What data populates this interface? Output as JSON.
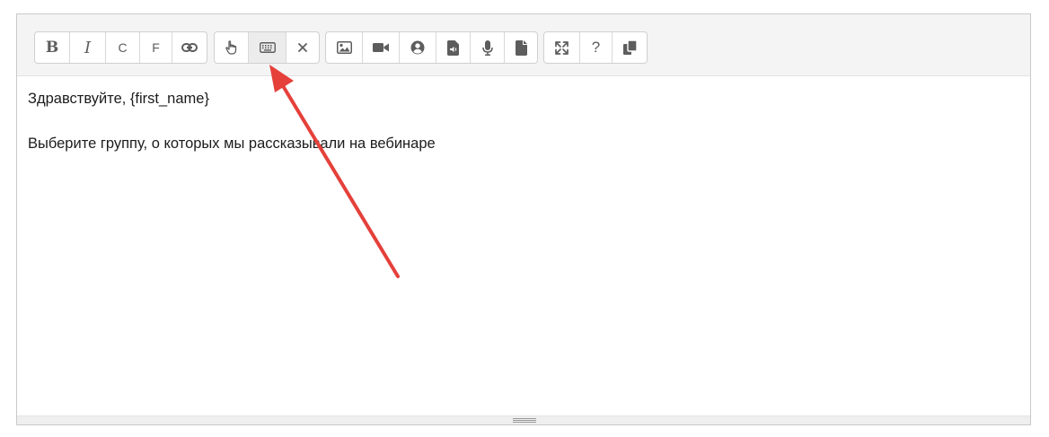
{
  "toolbar": {
    "format_group": [
      {
        "name": "bold-button",
        "label": "B",
        "icon": "bold"
      },
      {
        "name": "italic-button",
        "label": "I",
        "icon": "italic"
      },
      {
        "name": "c-button",
        "label": "C",
        "icon": "letter-c"
      },
      {
        "name": "f-button",
        "label": "F",
        "icon": "letter-f"
      },
      {
        "name": "link-button",
        "icon": "link-icon"
      }
    ],
    "keyboard_group": [
      {
        "name": "pointer-button",
        "icon": "hand-pointer-icon"
      },
      {
        "name": "keyboard-button",
        "icon": "keyboard-icon"
      },
      {
        "name": "clear-button",
        "icon": "close-icon"
      }
    ],
    "media_group": [
      {
        "name": "image-button",
        "icon": "image-icon"
      },
      {
        "name": "video-button",
        "icon": "video-icon"
      },
      {
        "name": "contact-button",
        "icon": "user-circle-icon"
      },
      {
        "name": "audio-file-button",
        "icon": "audio-file-icon"
      },
      {
        "name": "voice-button",
        "icon": "microphone-icon"
      },
      {
        "name": "document-button",
        "icon": "document-icon"
      }
    ],
    "view_group": [
      {
        "name": "fullscreen-button",
        "icon": "expand-icon"
      },
      {
        "name": "help-button",
        "label": "?",
        "icon": "question-icon"
      },
      {
        "name": "copy-button",
        "icon": "copy-icon"
      }
    ]
  },
  "content": {
    "line1": "Здравствуйте, {first_name}",
    "line2": "Выберите группу, о которых мы рассказывали на вебинаре"
  },
  "annotation": {
    "arrow_color": "#e5403a"
  },
  "colors": {
    "toolbar_bg": "#f4f4f4",
    "icon": "#5d5d5d",
    "border": "#c9c9c9"
  }
}
